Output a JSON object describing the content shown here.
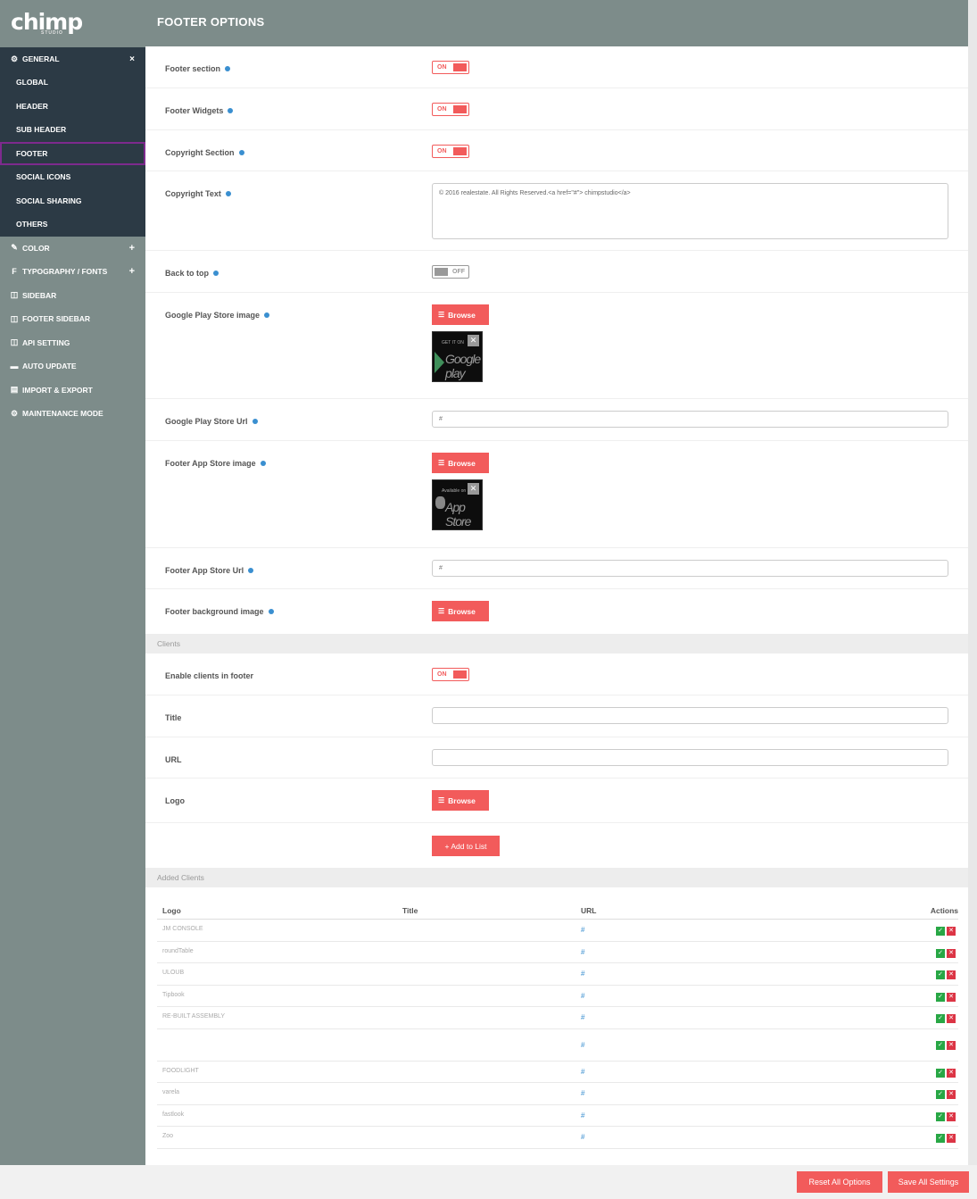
{
  "logo": {
    "main": "chimp",
    "sub": "STUDIO"
  },
  "header": {
    "title": "FOOTER OPTIONS"
  },
  "sidebar": {
    "general": {
      "label": "GENERAL",
      "toggle": "×"
    },
    "sub_items": [
      "GLOBAL",
      "HEADER",
      "SUB HEADER",
      "FOOTER",
      "SOCIAL ICONS",
      "SOCIAL SHARING",
      "OTHERS"
    ],
    "active_item": "FOOTER",
    "items": [
      {
        "label": "COLOR",
        "icon": "brush-icon",
        "glyph": "✎",
        "toggle": "+"
      },
      {
        "label": "TYPOGRAPHY / FONTS",
        "icon": "font-icon",
        "glyph": "f",
        "toggle": "+"
      },
      {
        "label": "SIDEBAR",
        "icon": "columns-icon",
        "glyph": "◫",
        "toggle": ""
      },
      {
        "label": "FOOTER SIDEBAR",
        "icon": "columns-icon",
        "glyph": "◫",
        "toggle": ""
      },
      {
        "label": "API SETTING",
        "icon": "columns-icon",
        "glyph": "◫",
        "toggle": ""
      },
      {
        "label": "AUTO UPDATE",
        "icon": "monitor-icon",
        "glyph": "▬",
        "toggle": ""
      },
      {
        "label": "IMPORT & EXPORT",
        "icon": "database-icon",
        "glyph": "▤",
        "toggle": ""
      },
      {
        "label": "MAINTENANCE MODE",
        "icon": "cogs-icon",
        "glyph": "⚙",
        "toggle": ""
      }
    ]
  },
  "settings": {
    "footer_section": {
      "label": "Footer section",
      "value": "ON"
    },
    "footer_widgets": {
      "label": "Footer Widgets",
      "value": "ON"
    },
    "copyright_section": {
      "label": "Copyright Section",
      "value": "ON"
    },
    "copyright_text": {
      "label": "Copyright Text",
      "value": "© 2016 realestate. All Rights Reserved.<a href=\"#\"> chimpstudio</a>"
    },
    "back_to_top": {
      "label": "Back to top",
      "value": "OFF"
    },
    "google_play_image": {
      "label": "Google Play Store image",
      "button": "Browse",
      "thumb_line1": "GET IT ON",
      "thumb_line2": "Google play"
    },
    "google_play_url": {
      "label": "Google Play Store Url",
      "value": "#"
    },
    "app_store_image": {
      "label": "Footer App Store image",
      "button": "Browse",
      "thumb_line1": "Available on",
      "thumb_line2": "App Store"
    },
    "app_store_url": {
      "label": "Footer App Store Url",
      "value": "#"
    },
    "footer_bg_image": {
      "label": "Footer background image",
      "button": "Browse"
    }
  },
  "clients_section": {
    "title": "Clients",
    "enable": {
      "label": "Enable clients in footer",
      "value": "ON"
    },
    "title_field": {
      "label": "Title",
      "value": ""
    },
    "url_field": {
      "label": "URL",
      "value": ""
    },
    "logo_field": {
      "label": "Logo",
      "button": "Browse"
    },
    "add_button": "+ Add to List"
  },
  "added_clients": {
    "title": "Added Clients",
    "columns": [
      "Logo",
      "Title",
      "URL",
      "Actions"
    ],
    "rows": [
      {
        "logo": "JM CONSOLE",
        "title": "",
        "url": "#"
      },
      {
        "logo": "roundTable",
        "title": "",
        "url": "#"
      },
      {
        "logo": "ULOUB",
        "title": "",
        "url": "#"
      },
      {
        "logo": "Tipbook",
        "title": "",
        "url": "#"
      },
      {
        "logo": "RE-BUILT ASSEMBLY",
        "title": "",
        "url": "#"
      },
      {
        "logo": "",
        "title": "",
        "url": "#"
      },
      {
        "logo": "FOODLIGHT",
        "title": "",
        "url": "#"
      },
      {
        "logo": "varela",
        "title": "",
        "url": "#"
      },
      {
        "logo": "fastlook",
        "title": "",
        "url": "#"
      },
      {
        "logo": "Zoo",
        "title": "",
        "url": "#"
      }
    ],
    "edit_symbol": "✓",
    "delete_symbol": "✕"
  },
  "footer": {
    "reset_label": "Reset All Options",
    "save_label": "Save All Settings"
  },
  "colors": {
    "accent": "#f25b5b",
    "sidebar_bg": "#7d8c8a",
    "nav_dark": "#2c3a45",
    "active_outline": "#7e2a8e",
    "help": "#3a8fd0"
  }
}
